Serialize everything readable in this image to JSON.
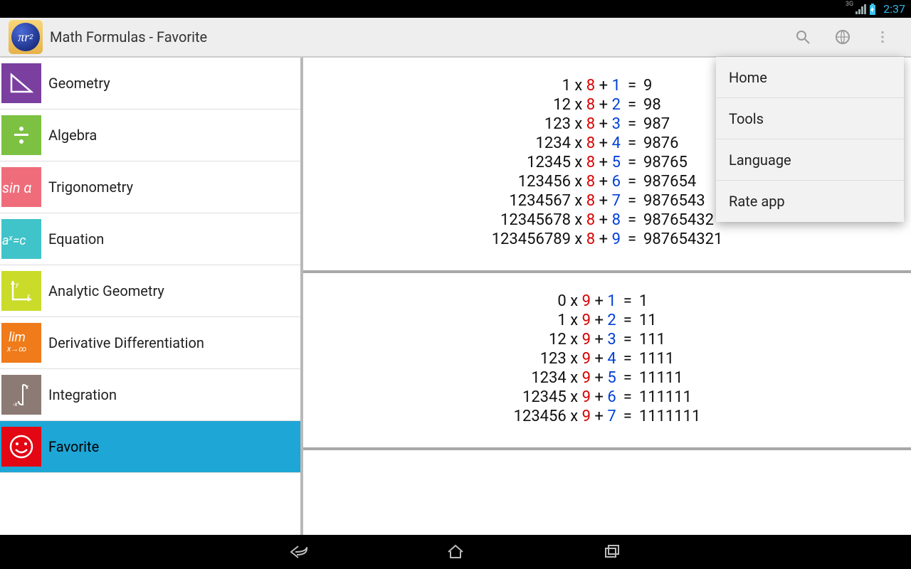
{
  "status": {
    "net": "3G",
    "time": "2:37"
  },
  "header": {
    "title": "Math Formulas - Favorite"
  },
  "sidebar": {
    "items": [
      {
        "label": "Geometry"
      },
      {
        "label": "Algebra"
      },
      {
        "label": "Trigonometry"
      },
      {
        "label": "Equation"
      },
      {
        "label": "Analytic Geometry"
      },
      {
        "label": "Derivative Differentiation"
      },
      {
        "label": "Integration"
      },
      {
        "label": "Favorite"
      }
    ],
    "selected_index": 7
  },
  "menu": {
    "items": [
      {
        "label": "Home"
      },
      {
        "label": "Tools"
      },
      {
        "label": "Language"
      },
      {
        "label": "Rate app"
      }
    ]
  },
  "content": {
    "blocks": [
      {
        "const": "8",
        "rows": [
          {
            "a": "1",
            "add": "1",
            "rhs": "9"
          },
          {
            "a": "12",
            "add": "2",
            "rhs": "98"
          },
          {
            "a": "123",
            "add": "3",
            "rhs": "987"
          },
          {
            "a": "1234",
            "add": "4",
            "rhs": "9876"
          },
          {
            "a": "12345",
            "add": "5",
            "rhs": "98765"
          },
          {
            "a": "123456",
            "add": "6",
            "rhs": "987654"
          },
          {
            "a": "1234567",
            "add": "7",
            "rhs": "9876543"
          },
          {
            "a": "12345678",
            "add": "8",
            "rhs": "98765432"
          },
          {
            "a": "123456789",
            "add": "9",
            "rhs": "987654321"
          }
        ]
      },
      {
        "const": "9",
        "rows": [
          {
            "a": "0",
            "add": "1",
            "rhs": "1"
          },
          {
            "a": "1",
            "add": "2",
            "rhs": "11"
          },
          {
            "a": "12",
            "add": "3",
            "rhs": "111"
          },
          {
            "a": "123",
            "add": "4",
            "rhs": "1111"
          },
          {
            "a": "1234",
            "add": "5",
            "rhs": "11111"
          },
          {
            "a": "12345",
            "add": "6",
            "rhs": "111111"
          },
          {
            "a": "123456",
            "add": "7",
            "rhs": "1111111"
          }
        ]
      }
    ]
  }
}
